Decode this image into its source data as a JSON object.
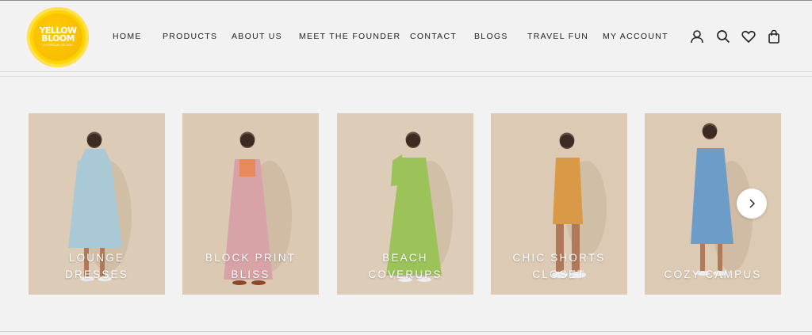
{
  "brand": {
    "line1": "YELLOW",
    "line2": "BLOOM",
    "tagline": "AS SPECIAL AS YOU"
  },
  "nav": {
    "items": [
      "HOME",
      "PRODUCTS",
      "ABOUT US",
      "MEET THE FOUNDER",
      "CONTACT",
      "BLOGS",
      "TRAVEL FUN",
      "MY ACCOUNT"
    ]
  },
  "header_icons": [
    "account-icon",
    "search-icon",
    "wishlist-heart-icon",
    "cart-bag-icon"
  ],
  "collections": [
    {
      "line1": "LOUNGE",
      "line2": "DRESSES",
      "dress_color": "#a9c9d6"
    },
    {
      "line1": "BLOCK PRINT",
      "line2": "BLISS",
      "dress_color": "#d8a3a6"
    },
    {
      "line1": "BEACH",
      "line2": "COVERUPS",
      "dress_color": "#9cc25a"
    },
    {
      "line1": "CHIC SHORTS",
      "line2": "CLOSET",
      "dress_color": "#d99a48"
    },
    {
      "line1": "",
      "line2": "COZY CAMPUS",
      "dress_color": "#6c9cc8"
    }
  ],
  "carousel": {
    "next_icon": "chevron-right-icon"
  },
  "colors": {
    "page_bg": "#f2f2f2",
    "logo_yellow": "#ffd400",
    "card_bg": "#d9c9b4"
  }
}
